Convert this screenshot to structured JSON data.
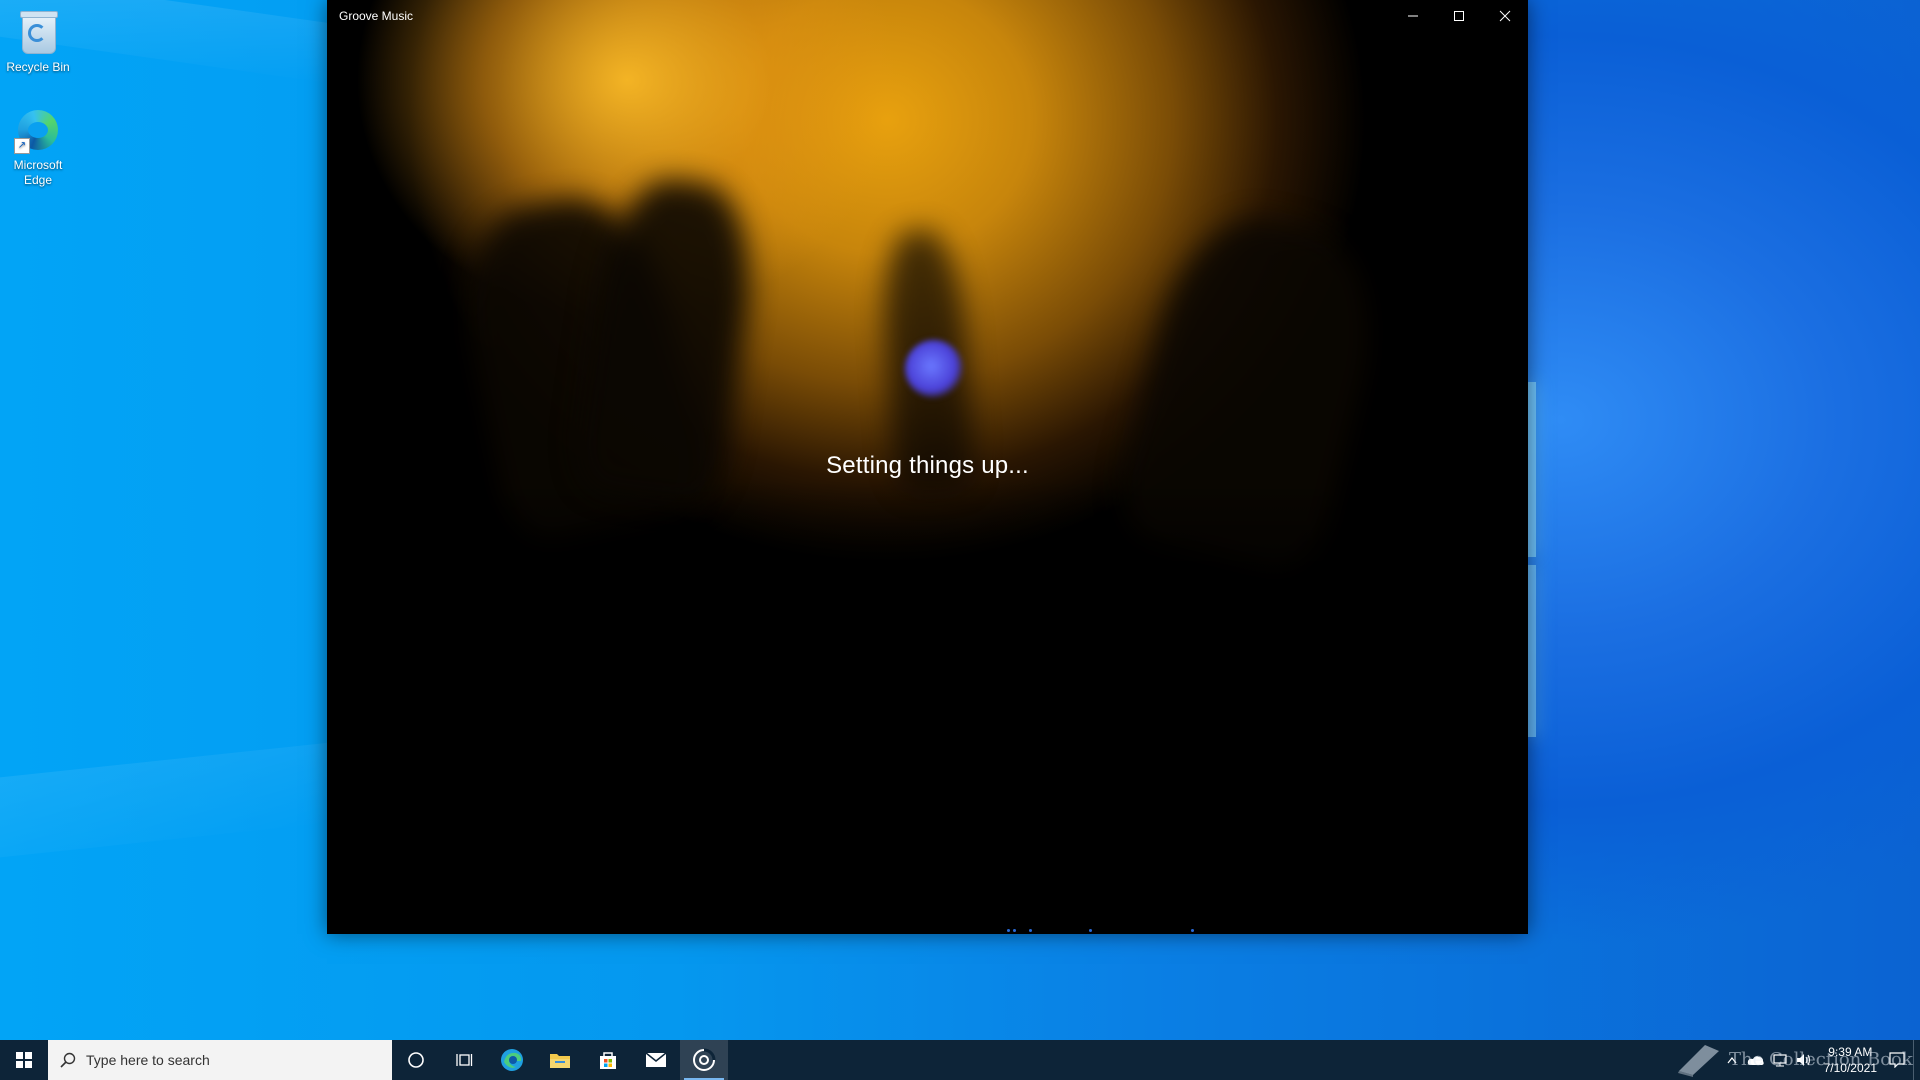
{
  "desktop": {
    "icons": [
      {
        "label": "Recycle Bin"
      },
      {
        "label": "Microsoft Edge"
      }
    ]
  },
  "window": {
    "title": "Groove Music",
    "status_text": "Setting things up...",
    "controls": {
      "minimize": "minimize-icon",
      "maximize": "maximize-icon",
      "close": "close-icon"
    }
  },
  "taskbar": {
    "search_placeholder": "Type here to search",
    "apps": [
      "start-icon",
      "cortana-icon",
      "task-view-icon",
      "edge-icon",
      "file-explorer-icon",
      "store-icon",
      "mail-icon",
      "groove-music-icon"
    ],
    "active_app": "groove-music-icon",
    "clock": {
      "time": "9:39 AM",
      "date": "7/10/2021"
    },
    "watermark": "The Collection Book"
  },
  "colors": {
    "taskbar": "#0d2438",
    "desktop_blue": "#0598ef",
    "accent": "#2a6bd9"
  }
}
